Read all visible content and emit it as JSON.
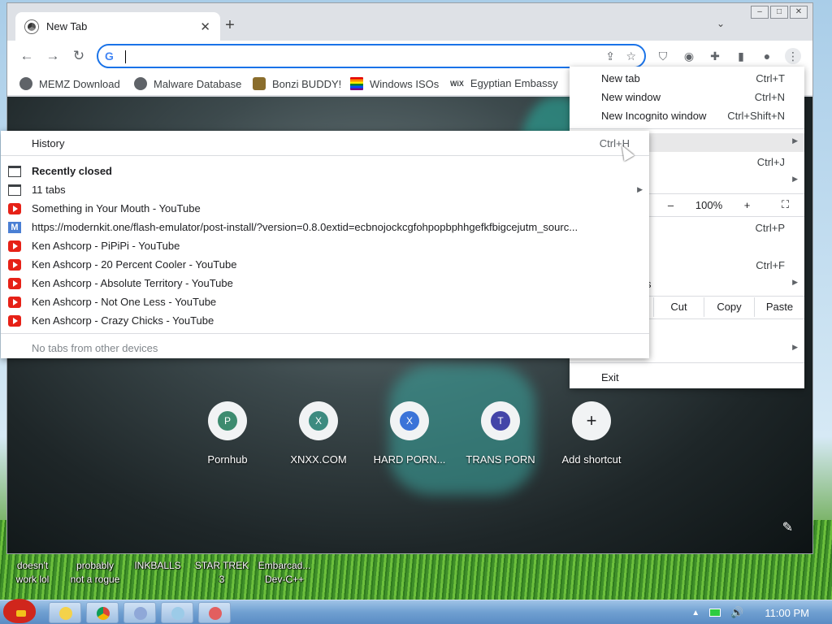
{
  "browser": {
    "tab": {
      "title": "New Tab",
      "close": "✕"
    },
    "new_tab_glyph": "+",
    "tab_search_glyph": "⌄",
    "window_controls": [
      "–",
      "□",
      "✕"
    ],
    "omnibox": {
      "value": "",
      "g_logo": "G"
    },
    "bookmarks": [
      {
        "label": "MEMZ Download",
        "icon": "globe-icon"
      },
      {
        "label": "Malware Database",
        "icon": "globe-icon"
      },
      {
        "label": "Bonzi BUDDY!",
        "icon": "bonzi-icon"
      },
      {
        "label": "Windows ISOs",
        "icon": "rainbow-icon"
      },
      {
        "label": "Egyptian Embassy",
        "icon": "wix-icon",
        "prefix": "WiX"
      }
    ],
    "shortcuts": [
      {
        "letter": "P",
        "label": "Pornhub",
        "color": "#3d8b6f"
      },
      {
        "letter": "X",
        "label": "XNXX.COM",
        "color": "#3d8b80"
      },
      {
        "letter": "X",
        "label": "HARD PORN...",
        "color": "#3b73d8"
      },
      {
        "letter": "T",
        "label": "TRANS PORN",
        "color": "#4345a8"
      },
      {
        "letter": "+",
        "label": "Add shortcut",
        "color": "#f1f3f4"
      }
    ]
  },
  "app_menu": {
    "new_tab": {
      "label": "New tab",
      "shortcut": "Ctrl+T"
    },
    "new_window": {
      "label": "New window",
      "shortcut": "Ctrl+N"
    },
    "new_incognito": {
      "label": "New Incognito window",
      "shortcut": "Ctrl+Shift+N"
    },
    "downloads_shortcut": "Ctrl+J",
    "partial_s1": "s",
    "partial_s2": "s",
    "zoom": {
      "minus": "–",
      "value": "100%",
      "plus": "+",
      "fullscreen": "⛶"
    },
    "print_shortcut": "Ctrl+P",
    "find_shortcut": "Ctrl+F",
    "partial_s3": "s",
    "edit": {
      "cut": "Cut",
      "copy": "Copy",
      "paste": "Paste"
    },
    "exit": "Exit"
  },
  "history_menu": {
    "history": {
      "label": "History",
      "shortcut": "Ctrl+H"
    },
    "recently_closed": "Recently closed",
    "tabs_group": "11 tabs",
    "items": [
      "Something in Your Mouth - YouTube",
      "https://modernkit.one/flash-emulator/post-install/?version=0.8.0extid=ecbnojockcgfohpopbphhgefkfbigcejutm_sourc...",
      "Ken Ashcorp - PiPiPi - YouTube",
      "Ken Ashcorp - 20 Percent Cooler - YouTube",
      "Ken Ashcorp - Absolute Territory - YouTube",
      "Ken Ashcorp - Not One Less - YouTube",
      "Ken Ashcorp - Crazy Chicks - YouTube"
    ],
    "other_devices": "No tabs from other devices"
  },
  "desktop_icons": [
    {
      "line1": "doesn't",
      "line2": "work lol"
    },
    {
      "line1": "probably",
      "line2": "not a rogue"
    },
    {
      "line1": "INKBALLS",
      "line2": ""
    },
    {
      "line1": "STAR TREK",
      "line2": "3"
    },
    {
      "line1": "Embarcad...",
      "line2": "Dev-C++"
    }
  ],
  "taskbar": {
    "clock": "11:00 PM"
  },
  "colors": {
    "accent": "#1a73e8",
    "youtube": "#e62117",
    "menu_hover": "#e8e8e9"
  }
}
